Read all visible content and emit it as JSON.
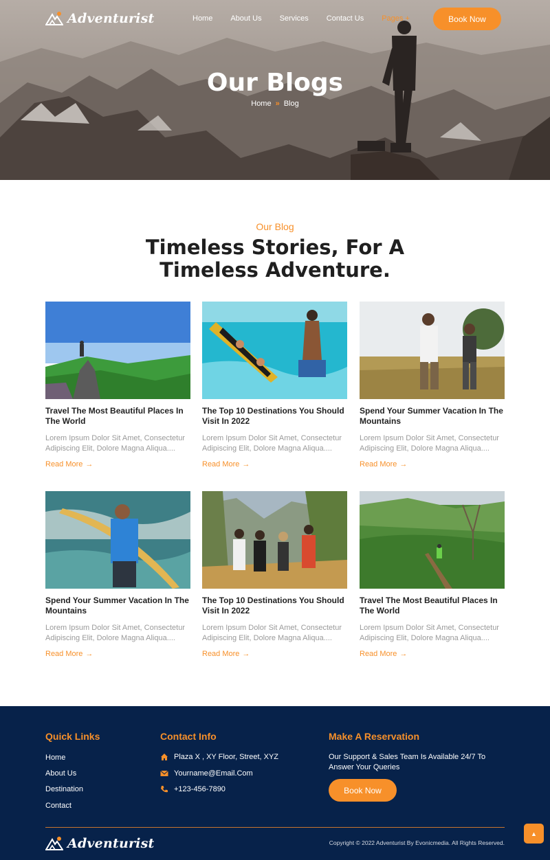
{
  "brand": {
    "name": "Adventurist",
    "accent": "#f7902a",
    "footer_bg": "#07224a"
  },
  "nav": {
    "items": [
      "Home",
      "About Us",
      "Services",
      "Contact Us",
      "Pages +"
    ],
    "active_index": 4,
    "book_label": "Book Now"
  },
  "hero": {
    "title": "Our Blogs",
    "breadcrumb": [
      "Home",
      "Blog"
    ],
    "breadcrumb_separator": "»"
  },
  "blog": {
    "eyebrow": "Our Blog",
    "headline": "Timeless Stories, For A Timeless Adventure.",
    "read_more": "Read More",
    "posts": [
      {
        "title": "Travel The Most Beautiful Places In The World",
        "excerpt": "Lorem Ipsum Dolor Sit Amet, Consectetur Adipiscing Elit, Dolore Magna Aliqua....",
        "image": "hiker-on-mountain-peak"
      },
      {
        "title": "The Top 10 Destinations You Should Visit In 2022",
        "excerpt": "Lorem Ipsum Dolor Sit Amet, Consectetur Adipiscing Elit, Dolore Magna Aliqua....",
        "image": "kayak-beach"
      },
      {
        "title": "Spend Your Summer Vacation In The Mountains",
        "excerpt": "Lorem Ipsum Dolor Sit Amet, Consectetur Adipiscing Elit, Dolore Magna Aliqua....",
        "image": "couple-hiking-field"
      },
      {
        "title": "Spend Your Summer Vacation In The Mountains",
        "excerpt": "Lorem Ipsum Dolor Sit Amet, Consectetur Adipiscing Elit, Dolore Magna Aliqua....",
        "image": "surfer-with-board"
      },
      {
        "title": "The Top 10 Destinations You Should Visit In 2022",
        "excerpt": "Lorem Ipsum Dolor Sit Amet, Consectetur Adipiscing Elit, Dolore Magna Aliqua....",
        "image": "group-hiking-canyon"
      },
      {
        "title": "Travel The Most Beautiful Places In The World",
        "excerpt": "Lorem Ipsum Dolor Sit Amet, Consectetur Adipiscing Elit, Dolore Magna Aliqua....",
        "image": "green-valley-trail"
      }
    ]
  },
  "footer": {
    "quick_links": {
      "heading": "Quick Links",
      "items": [
        "Home",
        "About Us",
        "Destination",
        "Contact"
      ]
    },
    "contact": {
      "heading": "Contact Info",
      "address": "Plaza X , XY Floor, Street, XYZ",
      "email": "Yourname@Email.Com",
      "phone": "+123-456-7890",
      "icons": [
        "home-icon",
        "envelope-icon",
        "phone-icon"
      ]
    },
    "reservation": {
      "heading": "Make A Reservation",
      "text": "Our Support & Sales Team Is Available 24/7 To Answer Your Queries",
      "button": "Book Now"
    },
    "copyright": "Copyright © 2022 Adventurist By Evonicmedia. All Rights Reserved."
  }
}
